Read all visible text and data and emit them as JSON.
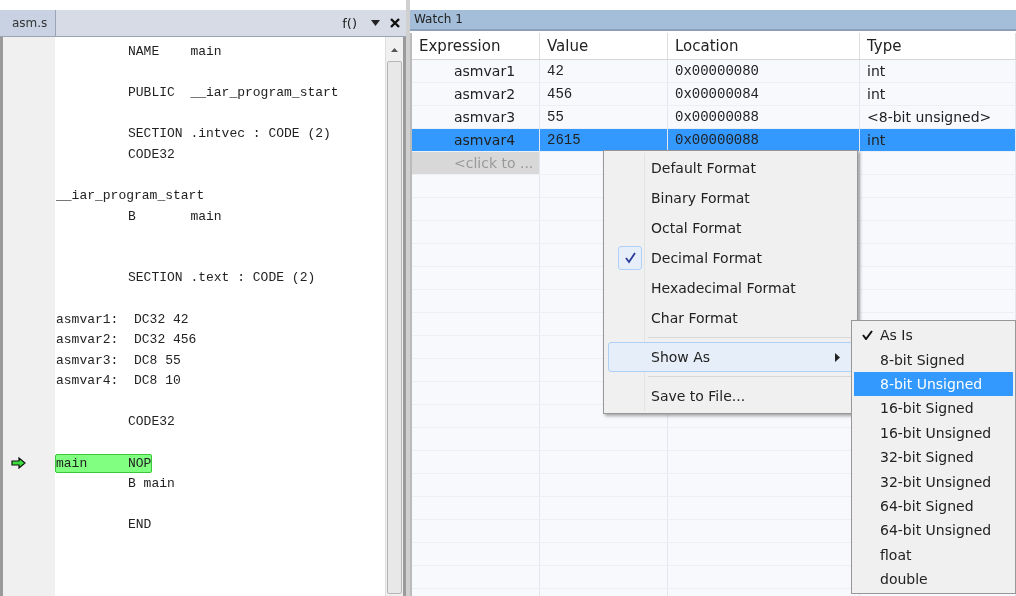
{
  "editor": {
    "tab": "asm.s",
    "function_box": "f()",
    "lines": [
      {
        "kind": "code",
        "code": "NAME    main",
        "current": false
      },
      {
        "kind": "blank"
      },
      {
        "kind": "code",
        "code": "PUBLIC  __iar_program_start",
        "current": false
      },
      {
        "kind": "blank"
      },
      {
        "kind": "code",
        "code": "SECTION .intvec : CODE (2)",
        "current": false
      },
      {
        "kind": "code",
        "code": "CODE32",
        "current": false
      },
      {
        "kind": "blank"
      },
      {
        "kind": "code",
        "label": "__iar_program_start",
        "current": false
      },
      {
        "kind": "code",
        "code": "B       main",
        "current": false
      },
      {
        "kind": "blank"
      },
      {
        "kind": "blank"
      },
      {
        "kind": "code",
        "code": "SECTION .text : CODE (2)",
        "current": false
      },
      {
        "kind": "blank"
      },
      {
        "kind": "code",
        "label": "asmvar1:  DC32 42",
        "current": false
      },
      {
        "kind": "code",
        "label": "asmvar2:  DC32 456",
        "current": false
      },
      {
        "kind": "code",
        "label": "asmvar3:  DC8 55",
        "current": false
      },
      {
        "kind": "code",
        "label": "asmvar4:  DC8 10",
        "current": false
      },
      {
        "kind": "blank"
      },
      {
        "kind": "code",
        "code": "CODE32",
        "current": false
      },
      {
        "kind": "blank"
      },
      {
        "kind": "code",
        "label": "main",
        "code": "NOP",
        "current": true
      },
      {
        "kind": "code",
        "code": "B main",
        "current": false
      },
      {
        "kind": "blank"
      },
      {
        "kind": "code",
        "code": "END",
        "current": false
      }
    ]
  },
  "watch": {
    "title": "Watch 1",
    "columns": [
      "Expression",
      "Value",
      "Location",
      "Type"
    ],
    "rows": [
      {
        "expression": "asmvar1",
        "value": "42",
        "location": "0x00000080",
        "type": "int",
        "selected": false
      },
      {
        "expression": "asmvar2",
        "value": "456",
        "location": "0x00000084",
        "type": "int",
        "selected": false
      },
      {
        "expression": "asmvar3",
        "value": "55",
        "location": "0x00000088",
        "type": "<8-bit unsigned>",
        "selected": false
      },
      {
        "expression": "asmvar4",
        "value": "2615",
        "location": "0x00000088",
        "type": "int",
        "selected": true
      }
    ],
    "add_row": {
      "placeholder": "<click to ..."
    }
  },
  "context_menu": {
    "sections": [
      [
        {
          "label": "Default Format",
          "checked": false,
          "submenu": false,
          "selected": false
        },
        {
          "label": "Binary Format",
          "checked": false,
          "submenu": false,
          "selected": false
        },
        {
          "label": "Octal Format",
          "checked": false,
          "submenu": false,
          "selected": false
        },
        {
          "label": "Decimal Format",
          "checked": true,
          "submenu": false,
          "selected": false
        },
        {
          "label": "Hexadecimal Format",
          "checked": false,
          "submenu": false,
          "selected": false
        },
        {
          "label": "Char Format",
          "checked": false,
          "submenu": false,
          "selected": false
        }
      ],
      [
        {
          "label": "Show As",
          "checked": false,
          "submenu": true,
          "selected": true
        }
      ],
      [
        {
          "label": "Save to File...",
          "checked": false,
          "submenu": false,
          "selected": false
        }
      ]
    ]
  },
  "submenu": {
    "items": [
      {
        "label": "As Is",
        "checked": true,
        "selected": false
      },
      {
        "label": "8-bit Signed",
        "checked": false,
        "selected": false
      },
      {
        "label": "8-bit Unsigned",
        "checked": false,
        "selected": true
      },
      {
        "label": "16-bit Signed",
        "checked": false,
        "selected": false
      },
      {
        "label": "16-bit Unsigned",
        "checked": false,
        "selected": false
      },
      {
        "label": "32-bit Signed",
        "checked": false,
        "selected": false
      },
      {
        "label": "32-bit Unsigned",
        "checked": false,
        "selected": false
      },
      {
        "label": "64-bit Signed",
        "checked": false,
        "selected": false
      },
      {
        "label": "64-bit Unsigned",
        "checked": false,
        "selected": false
      },
      {
        "label": "float",
        "checked": false,
        "selected": false
      },
      {
        "label": "double",
        "checked": false,
        "selected": false
      }
    ]
  }
}
